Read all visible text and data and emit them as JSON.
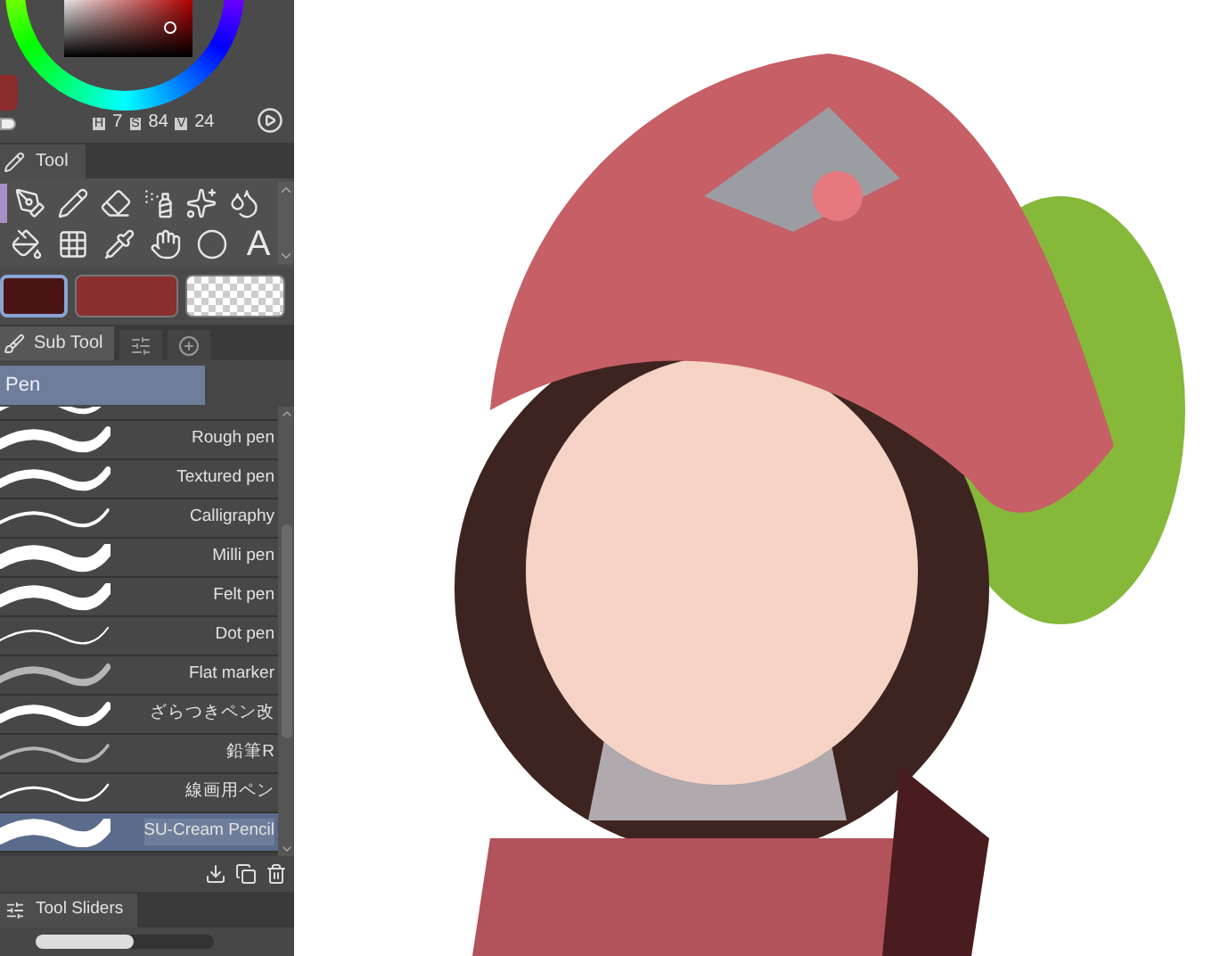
{
  "color": {
    "color": "#8b2b2b",
    "h_label": "H",
    "h": "7",
    "s_label": "S",
    "s": "84",
    "v_label": "V",
    "v": "24"
  },
  "tool_panel": {
    "title": "Tool",
    "tools": [
      {
        "kind": "current",
        "selected": true
      },
      {
        "kind": "pen",
        "selected": false
      },
      {
        "kind": "pencil",
        "selected": false
      },
      {
        "kind": "eraser",
        "selected": false
      },
      {
        "kind": "spray",
        "selected": false
      },
      {
        "kind": "sparkle",
        "selected": false
      },
      {
        "kind": "blend",
        "selected": false
      },
      {
        "kind": "fill",
        "selected": false
      },
      {
        "kind": "frame",
        "selected": false
      },
      {
        "kind": "eyedropper",
        "selected": false
      },
      {
        "kind": "hand",
        "selected": false
      },
      {
        "kind": "circle",
        "selected": false
      },
      {
        "kind": "text",
        "label": "A",
        "selected": false
      }
    ]
  },
  "colors": [
    {
      "kind": "main",
      "color": "#4a1414",
      "selected": true
    },
    {
      "kind": "sub",
      "color": "#8b2f2f",
      "selected": false
    },
    {
      "kind": "transparent",
      "selected": false
    }
  ],
  "sub_tool_panel": {
    "tabs": [
      {
        "kind": "text",
        "label": "Sub Tool",
        "selected": true
      },
      {
        "kind": "sliders",
        "selected": false
      },
      {
        "kind": "add",
        "selected": false
      }
    ],
    "group": "Pen",
    "brushes": [
      {
        "kind": "partial",
        "selected": false
      },
      {
        "name": "Rough pen",
        "selected": false
      },
      {
        "name": "Textured pen",
        "selected": false
      },
      {
        "name": "Calligraphy",
        "selected": false
      },
      {
        "name": "Milli pen",
        "selected": false
      },
      {
        "name": "Felt pen",
        "selected": false
      },
      {
        "name": "Dot pen",
        "selected": false
      },
      {
        "name": "Flat marker",
        "selected": false
      },
      {
        "name": "ざらつきペン改",
        "selected": false
      },
      {
        "name": "鉛筆R",
        "selected": false
      },
      {
        "name": "線画用ペン",
        "selected": false
      },
      {
        "name": "SU-Cream Pencil",
        "selected": true
      }
    ]
  },
  "tool_sliders": {
    "title": "Tool Sliders",
    "level": 0.55
  }
}
